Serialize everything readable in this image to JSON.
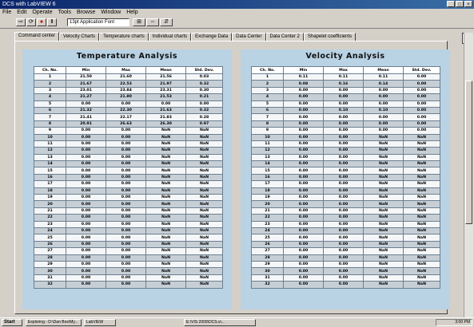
{
  "window": {
    "title": "DCS with LabVIEW 6",
    "controls": [
      "_",
      "□",
      "×"
    ]
  },
  "menu": [
    "File",
    "Edit",
    "Operate",
    "Tools",
    "Browse",
    "Window",
    "Help"
  ],
  "toolbar": {
    "font_field": "13pt Application Font"
  },
  "tabs": [
    "Command center",
    "Velocity Charts",
    "Temperature charts",
    "Individual charts",
    "Exchange Data",
    "Data Center",
    "Data Center 2",
    "Shapelet coefficients"
  ],
  "active_tab_index": 0,
  "temperature_table": {
    "title": "Temperature Analysis",
    "columns": [
      "Ch. No.",
      "Min",
      "Max",
      "Mean",
      "Std. Dev."
    ],
    "rows": [
      [
        "1",
        "21.50",
        "21.60",
        "21.56",
        "0.03"
      ],
      [
        "2",
        "21.67",
        "22.53",
        "21.97",
        "0.32"
      ],
      [
        "3",
        "23.01",
        "23.84",
        "23.31",
        "0.30"
      ],
      [
        "4",
        "21.27",
        "21.80",
        "21.53",
        "0.21"
      ],
      [
        "5",
        "0.00",
        "0.00",
        "0.00",
        "0.00"
      ],
      [
        "6",
        "21.32",
        "22.30",
        "21.63",
        "0.32"
      ],
      [
        "7",
        "21.41",
        "22.17",
        "21.83",
        "0.28"
      ],
      [
        "8",
        "20.91",
        "26.63",
        "26.30",
        "0.97"
      ],
      [
        "9",
        "0.00",
        "0.00",
        "NaN",
        "NaN"
      ],
      [
        "10",
        "0.00",
        "0.00",
        "NaN",
        "NaN"
      ],
      [
        "11",
        "0.00",
        "0.00",
        "NaN",
        "NaN"
      ],
      [
        "12",
        "0.00",
        "0.00",
        "NaN",
        "NaN"
      ],
      [
        "13",
        "0.00",
        "0.00",
        "NaN",
        "NaN"
      ],
      [
        "14",
        "0.00",
        "0.00",
        "NaN",
        "NaN"
      ],
      [
        "15",
        "0.00",
        "0.00",
        "NaN",
        "NaN"
      ],
      [
        "16",
        "0.00",
        "0.00",
        "NaN",
        "NaN"
      ],
      [
        "17",
        "0.00",
        "0.00",
        "NaN",
        "NaN"
      ],
      [
        "18",
        "0.00",
        "0.00",
        "NaN",
        "NaN"
      ],
      [
        "19",
        "0.00",
        "0.00",
        "NaN",
        "NaN"
      ],
      [
        "20",
        "0.00",
        "0.00",
        "NaN",
        "NaN"
      ],
      [
        "21",
        "0.00",
        "0.00",
        "NaN",
        "NaN"
      ],
      [
        "22",
        "0.00",
        "0.00",
        "NaN",
        "NaN"
      ],
      [
        "23",
        "0.00",
        "0.00",
        "NaN",
        "NaN"
      ],
      [
        "24",
        "0.00",
        "0.00",
        "NaN",
        "NaN"
      ],
      [
        "25",
        "0.00",
        "0.00",
        "NaN",
        "NaN"
      ],
      [
        "26",
        "0.00",
        "0.00",
        "NaN",
        "NaN"
      ],
      [
        "27",
        "0.00",
        "0.00",
        "NaN",
        "NaN"
      ],
      [
        "28",
        "0.00",
        "0.00",
        "NaN",
        "NaN"
      ],
      [
        "29",
        "0.00",
        "0.00",
        "NaN",
        "NaN"
      ],
      [
        "30",
        "0.00",
        "0.00",
        "NaN",
        "NaN"
      ],
      [
        "31",
        "0.00",
        "0.00",
        "NaN",
        "NaN"
      ],
      [
        "32",
        "0.00",
        "0.00",
        "NaN",
        "NaN"
      ]
    ]
  },
  "velocity_table": {
    "title": "Velocity Analysis",
    "columns": [
      "Ch. No.",
      "Min",
      "Max",
      "Mean",
      "Std. Dev."
    ],
    "rows": [
      [
        "1",
        "0.11",
        "0.11",
        "0.11",
        "0.00"
      ],
      [
        "2",
        "0.08",
        "0.16",
        "0.14",
        "0.00"
      ],
      [
        "3",
        "0.00",
        "0.00",
        "0.00",
        "0.00"
      ],
      [
        "4",
        "0.00",
        "0.00",
        "0.00",
        "0.00"
      ],
      [
        "5",
        "0.00",
        "0.00",
        "0.00",
        "0.00"
      ],
      [
        "6",
        "0.00",
        "0.10",
        "0.10",
        "0.00"
      ],
      [
        "7",
        "0.00",
        "0.00",
        "0.00",
        "0.00"
      ],
      [
        "8",
        "0.00",
        "0.00",
        "0.00",
        "0.00"
      ],
      [
        "9",
        "0.00",
        "0.00",
        "0.00",
        "0.00"
      ],
      [
        "10",
        "0.00",
        "0.00",
        "NaN",
        "NaN"
      ],
      [
        "11",
        "0.00",
        "0.00",
        "NaN",
        "NaN"
      ],
      [
        "12",
        "0.00",
        "0.00",
        "NaN",
        "NaN"
      ],
      [
        "13",
        "0.00",
        "0.00",
        "NaN",
        "NaN"
      ],
      [
        "14",
        "0.00",
        "0.00",
        "NaN",
        "NaN"
      ],
      [
        "15",
        "0.00",
        "0.00",
        "NaN",
        "NaN"
      ],
      [
        "16",
        "0.00",
        "0.00",
        "NaN",
        "NaN"
      ],
      [
        "17",
        "0.00",
        "0.00",
        "NaN",
        "NaN"
      ],
      [
        "18",
        "0.00",
        "0.00",
        "NaN",
        "NaN"
      ],
      [
        "19",
        "0.00",
        "0.00",
        "NaN",
        "NaN"
      ],
      [
        "20",
        "0.00",
        "0.00",
        "NaN",
        "NaN"
      ],
      [
        "21",
        "0.00",
        "0.00",
        "NaN",
        "NaN"
      ],
      [
        "22",
        "0.00",
        "0.00",
        "NaN",
        "NaN"
      ],
      [
        "23",
        "0.00",
        "0.00",
        "NaN",
        "NaN"
      ],
      [
        "24",
        "0.00",
        "0.00",
        "NaN",
        "NaN"
      ],
      [
        "25",
        "0.00",
        "0.00",
        "NaN",
        "NaN"
      ],
      [
        "26",
        "0.00",
        "0.00",
        "NaN",
        "NaN"
      ],
      [
        "27",
        "0.00",
        "0.00",
        "NaN",
        "NaN"
      ],
      [
        "28",
        "0.00",
        "0.00",
        "NaN",
        "NaN"
      ],
      [
        "29",
        "0.00",
        "0.00",
        "NaN",
        "NaN"
      ],
      [
        "30",
        "0.00",
        "0.00",
        "NaN",
        "NaN"
      ],
      [
        "31",
        "0.00",
        "0.00",
        "NaN",
        "NaN"
      ],
      [
        "32",
        "0.00",
        "0.00",
        "NaN",
        "NaN"
      ]
    ]
  },
  "taskbar": {
    "start": "Start",
    "items": [
      "Exploring - D:\\Dan Bos\\My...",
      "LabVIEW",
      "E:\\VIS 2009\\DCS.vi..."
    ],
    "clock": "3:00 PM"
  },
  "colors": {
    "panel_bg": "#b9d2e4",
    "title_bar": "#0a246a",
    "row_alt": "#c7cfd6"
  }
}
